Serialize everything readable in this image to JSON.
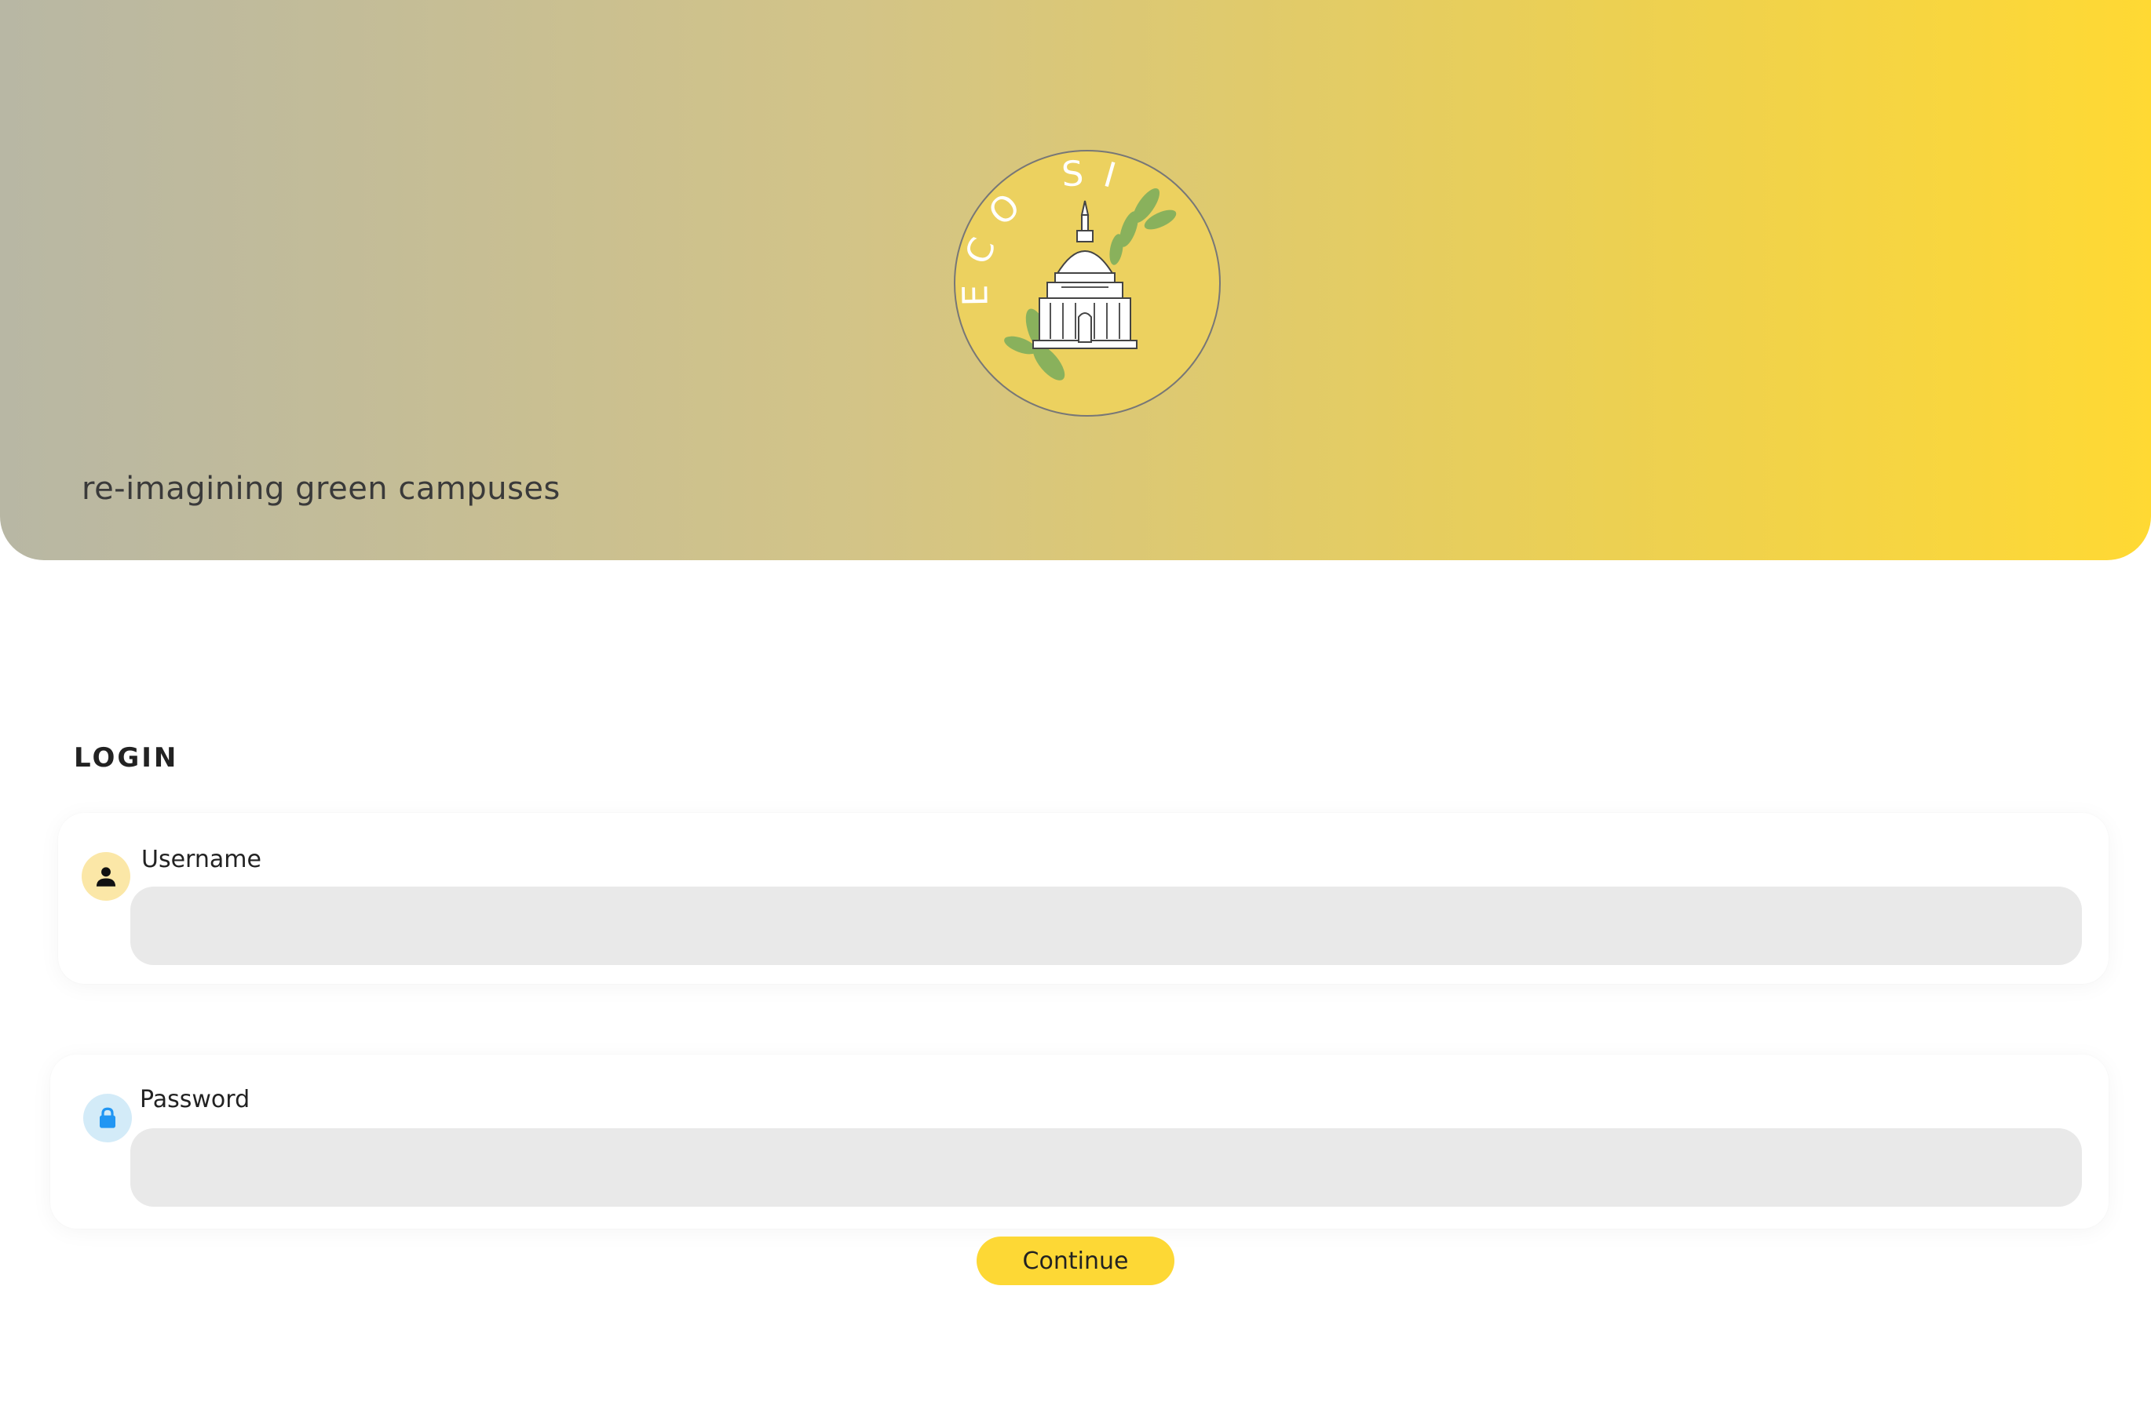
{
  "hero": {
    "tagline": "re-imagining green campuses",
    "logo": {
      "arc_text": "ECO SIST",
      "icon": "domed-building-with-leaves-icon",
      "color": "#ecd15f"
    },
    "gradient": [
      "#b8b7a4",
      "#ffd933"
    ]
  },
  "login": {
    "title": "LOGIN",
    "username": {
      "label": "Username",
      "icon": "user-icon",
      "value": "",
      "placeholder": ""
    },
    "password": {
      "label": "Password",
      "icon": "lock-icon",
      "value": "",
      "placeholder": ""
    },
    "continue_label": "Continue"
  },
  "colors": {
    "accent": "#fdd835",
    "input_bg": "#e9e9e9",
    "user_icon_bg": "#fbe7a7",
    "lock_icon_bg": "#d3ebf8",
    "lock_icon": "#2196f3"
  }
}
